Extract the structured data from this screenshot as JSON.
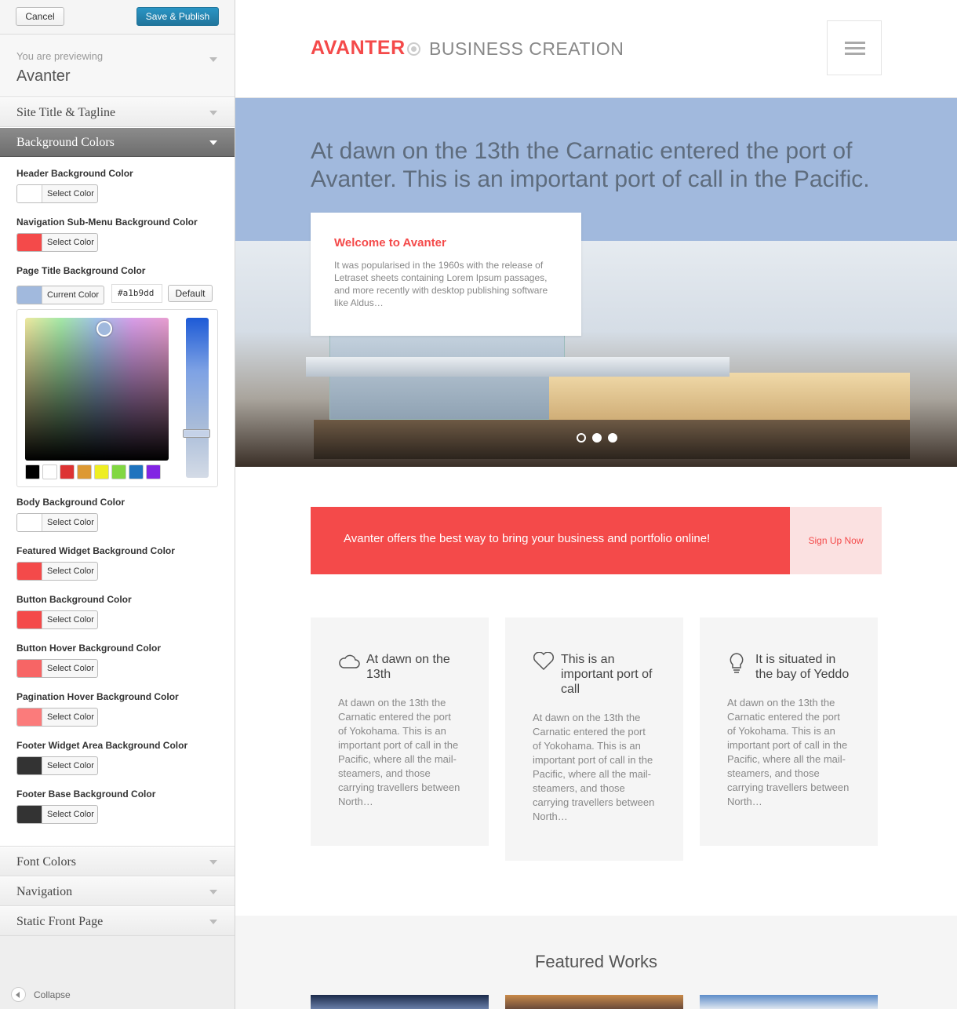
{
  "toolbar": {
    "cancel_label": "Cancel",
    "publish_label": "Save & Publish"
  },
  "preview_info": {
    "label": "You are previewing",
    "theme": "Avanter"
  },
  "sections": {
    "site_title": "Site Title & Tagline",
    "background_colors": "Background Colors",
    "font_colors": "Font Colors",
    "navigation": "Navigation",
    "static_front_page": "Static Front Page"
  },
  "controls": [
    {
      "label": "Header Background Color",
      "button": "Select Color",
      "color": "#ffffff"
    },
    {
      "label": "Navigation Sub-Menu Background Color",
      "button": "Select Color",
      "color": "#f44a4a"
    },
    {
      "label": "Page Title Background Color",
      "button": "Current Color",
      "color": "#a1b9dd",
      "hex": "#a1b9dd",
      "default_label": "Default"
    },
    {
      "label": "Body Background Color",
      "button": "Select Color",
      "color": "#ffffff"
    },
    {
      "label": "Featured Widget Background Color",
      "button": "Select Color",
      "color": "#f44a4a"
    },
    {
      "label": "Button Background Color",
      "button": "Select Color",
      "color": "#f44a4a"
    },
    {
      "label": "Button Hover Background Color",
      "button": "Select Color",
      "color": "#f76565"
    },
    {
      "label": "Pagination Hover Background Color",
      "button": "Select Color",
      "color": "#fb7b7b"
    },
    {
      "label": "Footer Widget Area Background Color",
      "button": "Select Color",
      "color": "#333333"
    },
    {
      "label": "Footer Base Background Color",
      "button": "Select Color",
      "color": "#333333"
    }
  ],
  "palette": [
    "#000000",
    "#ffffff",
    "#dd3333",
    "#dd9933",
    "#eeee22",
    "#81d742",
    "#1e73be",
    "#8224e3"
  ],
  "collapse_label": "Collapse",
  "site": {
    "logo": "AVANTER",
    "tagline": "BUSINESS CREATION",
    "hero_text": "At dawn on the 13th the Carnatic entered the port of Avanter. This is an important port of call in the Pacific.",
    "welcome_title": "Welcome to Avanter",
    "welcome_text": "It was popularised in the 1960s with the release of Letraset sheets containing Lorem Ipsum passages, and more recently with desktop publishing software like Aldus…",
    "cta_text": "Avanter offers the best way to bring your business and portfolio online!",
    "cta_button": "Sign Up Now",
    "features": [
      {
        "icon": "cloud-icon",
        "title": "At dawn on the 13th",
        "body": "At dawn on the 13th the Carnatic entered the port of Yokohama.  This is an important port of call in the Pacific, where all the mail-steamers, and those carrying travellers between North…"
      },
      {
        "icon": "heart-icon",
        "title": "This is an important port of call",
        "body": "At dawn on the 13th the Carnatic entered the port of Yokohama.  This is an important port of call in the Pacific, where all the mail-steamers, and those carrying travellers between North…"
      },
      {
        "icon": "lightbulb-icon",
        "title": "It is situated in the bay of Yeddo",
        "body": "At dawn on the 13th the Carnatic entered the port of Yokohama.  This is an important port of call in the Pacific, where all the mail-steamers, and those carrying travellers between North…"
      }
    ],
    "works_title": "Featured Works"
  },
  "colors": {
    "accent": "#f44a4a",
    "page_title_bg": "#a1b9dd",
    "wp_blue": "#21759b"
  }
}
